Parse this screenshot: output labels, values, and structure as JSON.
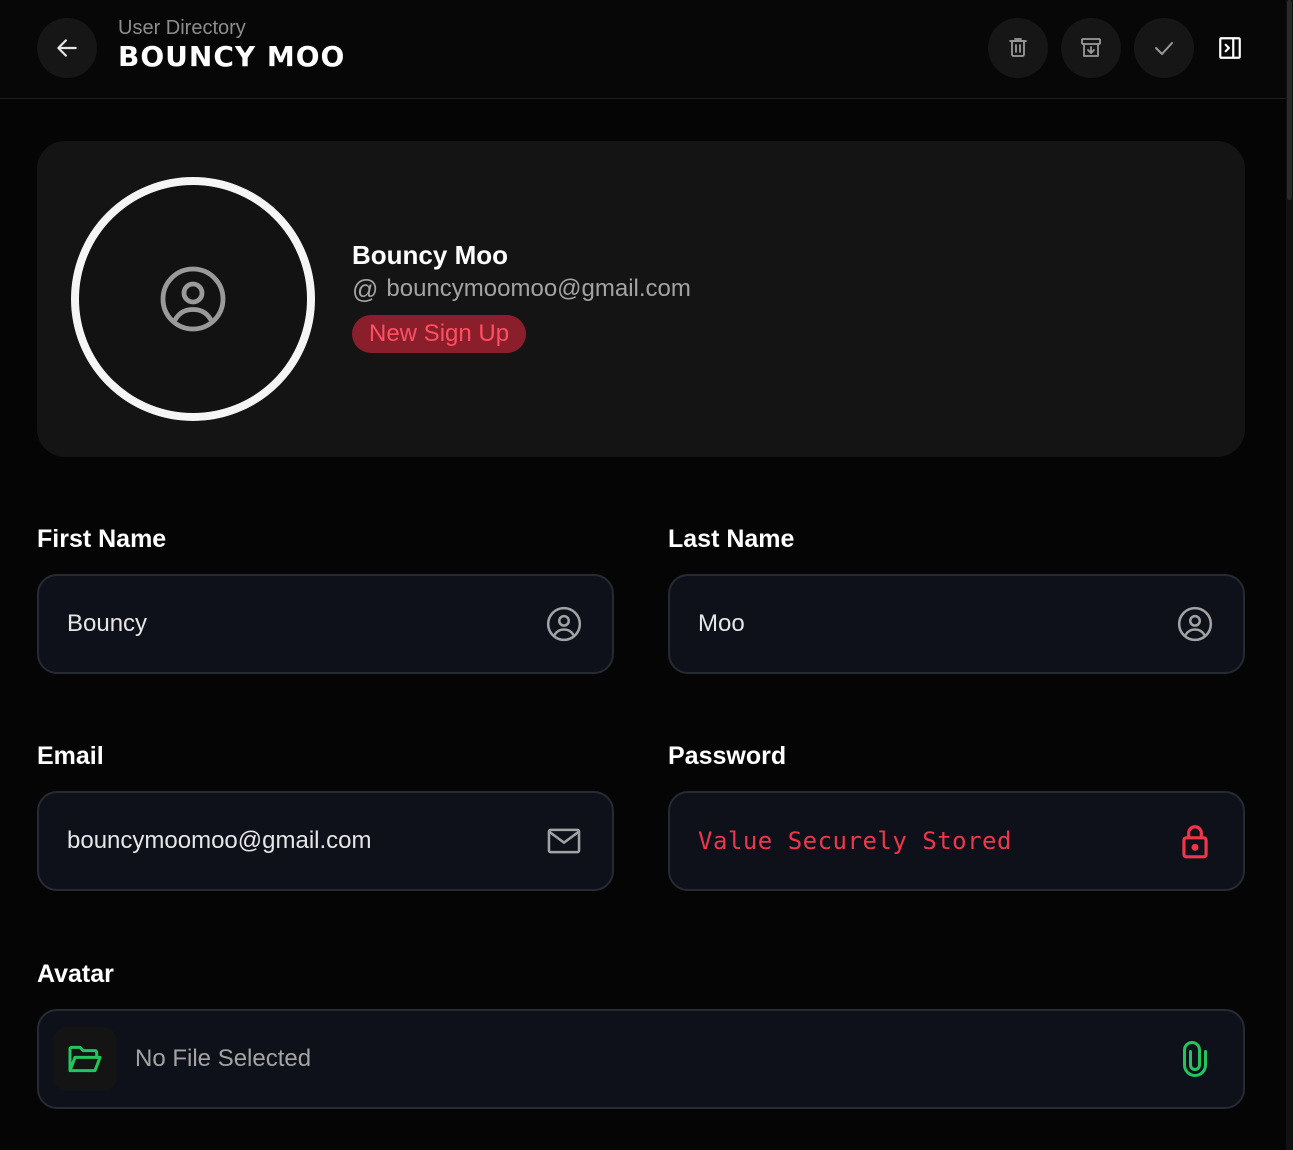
{
  "header": {
    "breadcrumb": "User Directory",
    "title": "Bouncy Moo",
    "actions": {
      "back": "arrow-left-icon",
      "delete": "trash-icon",
      "archive": "archive-icon",
      "confirm": "check-icon",
      "panel": "panel-right-icon"
    }
  },
  "profile": {
    "name": "Bouncy Moo",
    "at_symbol": "@",
    "email": "bouncymoomoo@gmail.com",
    "badge": "New Sign Up",
    "badge_bg": "#8a1f2b",
    "badge_color": "#ff4f62"
  },
  "form": {
    "first_name": {
      "label": "First Name",
      "value": "Bouncy",
      "icon": "user-circle-icon"
    },
    "last_name": {
      "label": "Last Name",
      "value": "Moo",
      "icon": "user-circle-icon"
    },
    "email": {
      "label": "Email",
      "value": "bouncymoomoo@gmail.com",
      "icon": "mail-icon"
    },
    "password": {
      "label": "Password",
      "value": "Value Securely Stored",
      "icon": "lock-icon",
      "color": "#f0364b"
    },
    "avatar": {
      "label": "Avatar",
      "value": "No File Selected",
      "icon": "folder-open-icon",
      "attach_icon": "paperclip-icon",
      "accent": "#22c55e"
    }
  }
}
